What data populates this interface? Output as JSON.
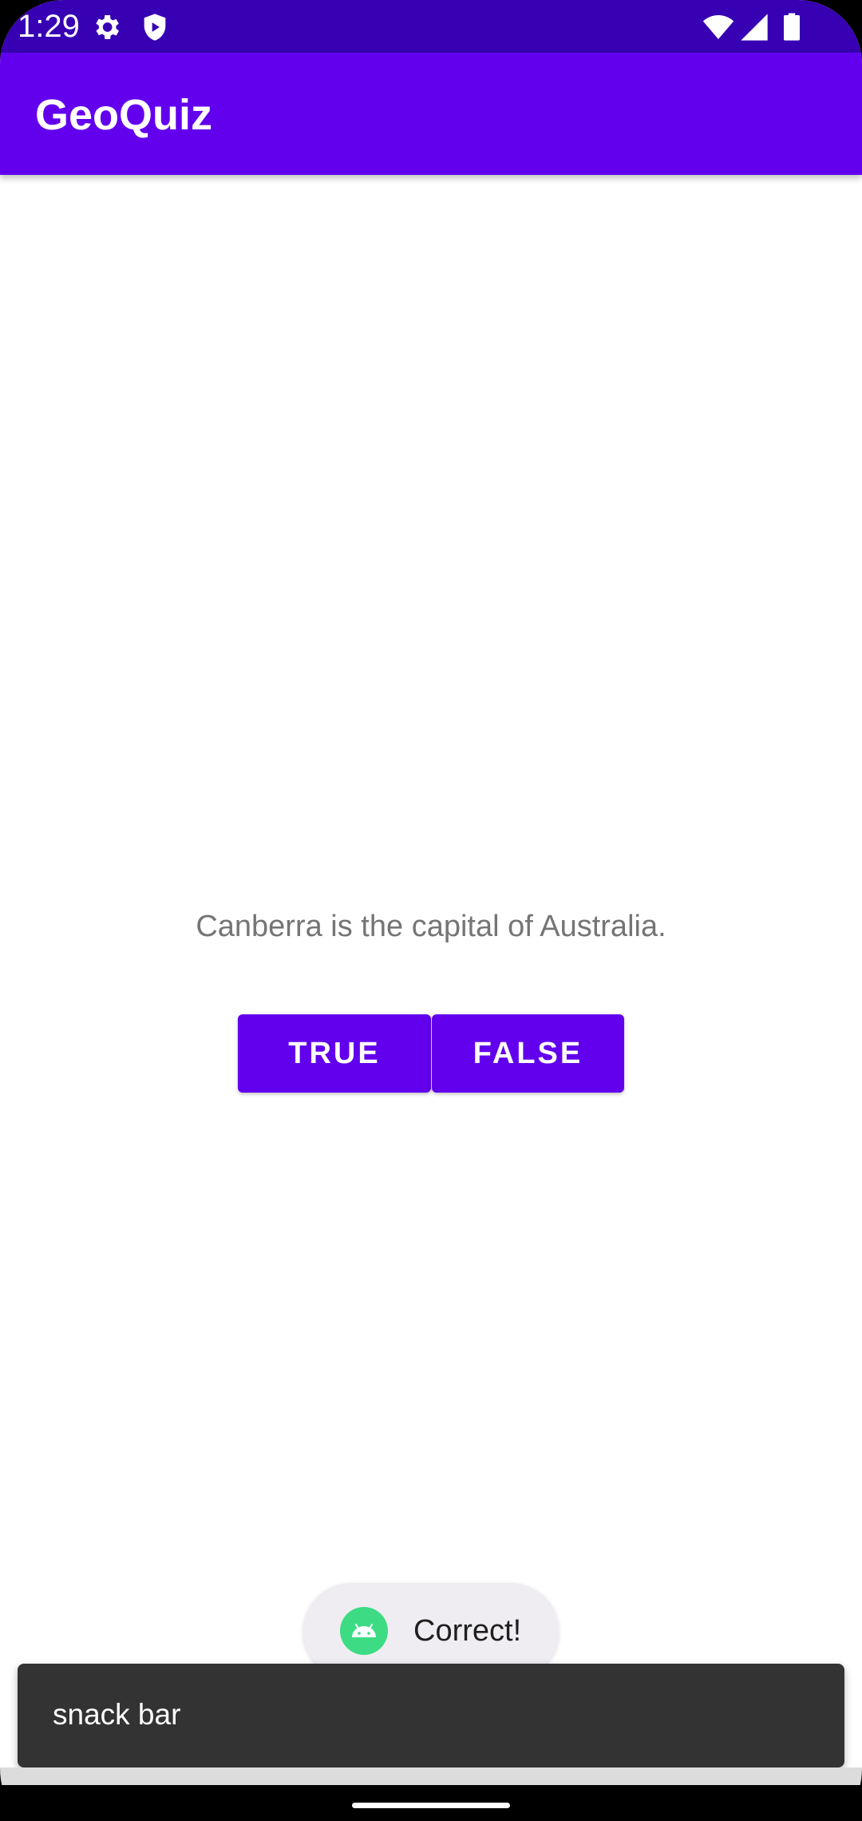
{
  "status_bar": {
    "time": "1:29",
    "icons": [
      "gear-icon",
      "shield-icon",
      "wifi-icon",
      "signal-icon",
      "battery-icon"
    ]
  },
  "app_bar": {
    "title": "GeoQuiz",
    "color": "#6200ee",
    "status_color": "#3700b3"
  },
  "quiz": {
    "question": "Canberra is the capital of Australia.",
    "true_label": "TRUE",
    "false_label": "FALSE"
  },
  "toast": {
    "icon": "android-icon",
    "text": "Correct!"
  },
  "snackbar": {
    "text": "snack bar"
  }
}
